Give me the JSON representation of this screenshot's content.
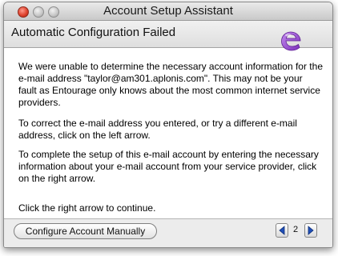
{
  "window": {
    "title": "Account Setup Assistant"
  },
  "header": {
    "title": "Automatic Configuration Failed"
  },
  "logo": {
    "icon": "entourage-logo-icon",
    "accent_color": "#8a3fc8"
  },
  "content": {
    "paragraph1": "We were unable to determine the necessary account information for the e-mail address \"taylor@am301.aplonis.com\". This may not be your fault as Entourage only knows about the most common internet service providers.",
    "paragraph2": "To correct the e-mail address you entered, or try a different e-mail address, click on the left arrow.",
    "paragraph3": "To complete the setup of this e-mail account by entering the necessary information about your e-mail account from your service provider, click on the right arrow.",
    "paragraph4": "Click the right arrow to continue."
  },
  "footer": {
    "configure_manually_label": "Configure Account Manually",
    "page_number": "2",
    "prev_icon": "left-arrow-icon",
    "next_icon": "right-arrow-icon"
  }
}
